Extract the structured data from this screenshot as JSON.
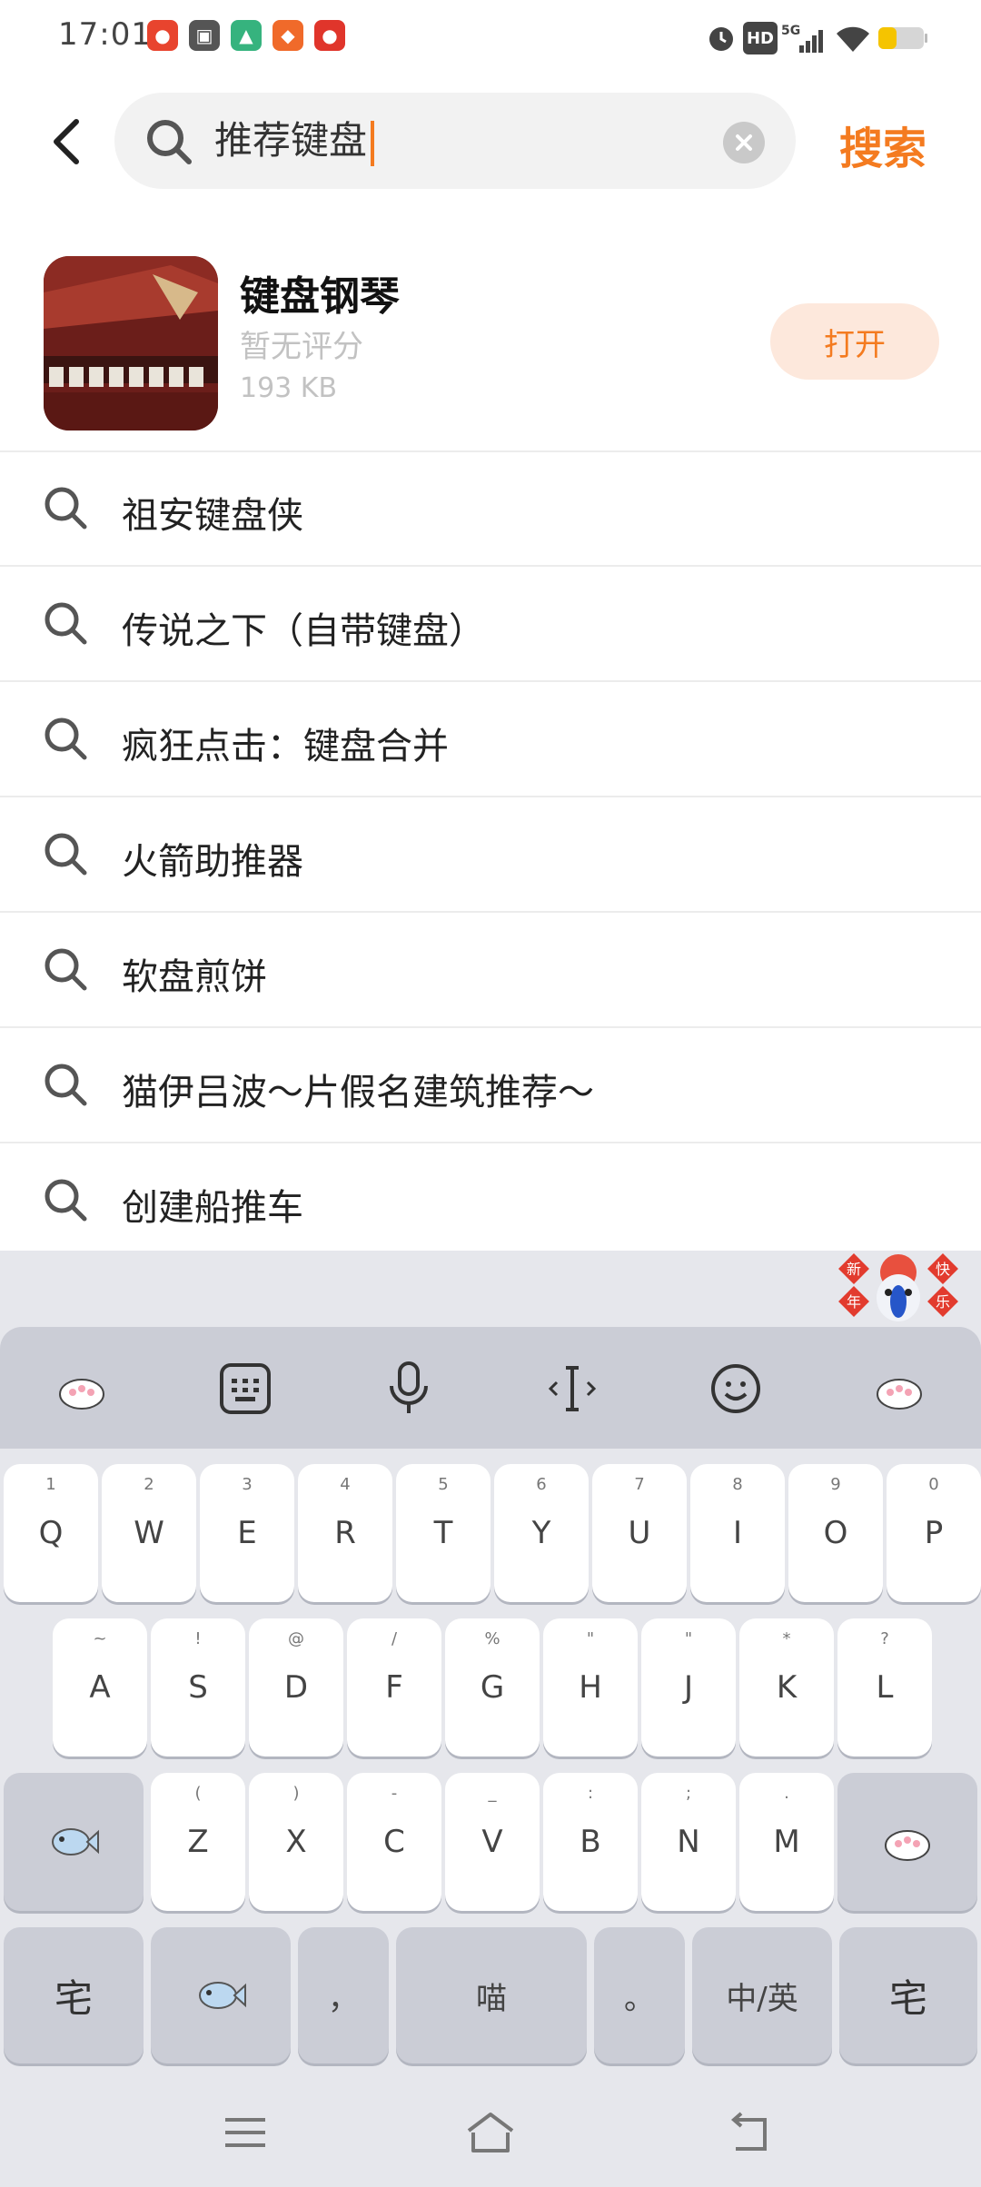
{
  "status_bar": {
    "time": "17:01",
    "network_label": "5G",
    "hd_label": "HD",
    "notification_icons": [
      "app-notif-icon",
      "app-notif-icon",
      "app-notif-icon",
      "app-notif-icon",
      "app-notif-icon"
    ],
    "battery_color": "#f5c400"
  },
  "header": {
    "search_value": "推荐键盘",
    "search_button_label": "搜索",
    "accent_color": "#f47b20"
  },
  "app_result": {
    "name": "键盘钢琴",
    "rating": "暂无评分",
    "size": "193 KB",
    "open_label": "打开"
  },
  "suggestions": [
    "祖安键盘侠",
    "传说之下（自带键盘）",
    "疯狂点击：键盘合并",
    "火箭助推器",
    "软盘煎饼",
    "猫伊吕波～片假名建筑推荐～",
    "创建船推车"
  ],
  "keyboard": {
    "mascot_text": [
      "新",
      "年",
      "快",
      "乐"
    ],
    "row1": [
      {
        "k": "Q",
        "s": "1"
      },
      {
        "k": "W",
        "s": "2"
      },
      {
        "k": "E",
        "s": "3"
      },
      {
        "k": "R",
        "s": "4"
      },
      {
        "k": "T",
        "s": "5"
      },
      {
        "k": "Y",
        "s": "6"
      },
      {
        "k": "U",
        "s": "7"
      },
      {
        "k": "I",
        "s": "8"
      },
      {
        "k": "O",
        "s": "9"
      },
      {
        "k": "P",
        "s": "0"
      }
    ],
    "row2": [
      {
        "k": "A",
        "s": "~"
      },
      {
        "k": "S",
        "s": "!"
      },
      {
        "k": "D",
        "s": "@"
      },
      {
        "k": "F",
        "s": "/"
      },
      {
        "k": "G",
        "s": "%"
      },
      {
        "k": "H",
        "s": "\""
      },
      {
        "k": "J",
        "s": "\""
      },
      {
        "k": "K",
        "s": "*"
      },
      {
        "k": "L",
        "s": "?"
      }
    ],
    "row3": [
      {
        "k": "Z",
        "s": "("
      },
      {
        "k": "X",
        "s": ")"
      },
      {
        "k": "C",
        "s": "-"
      },
      {
        "k": "V",
        "s": "_"
      },
      {
        "k": "B",
        "s": ":"
      },
      {
        "k": "N",
        "s": ";"
      },
      {
        "k": "M",
        "s": "."
      }
    ],
    "bottom": {
      "left_key": "宅",
      "comma": "，",
      "space": "喵",
      "period": "。",
      "lang": "中/英",
      "right_key": "宅"
    }
  }
}
